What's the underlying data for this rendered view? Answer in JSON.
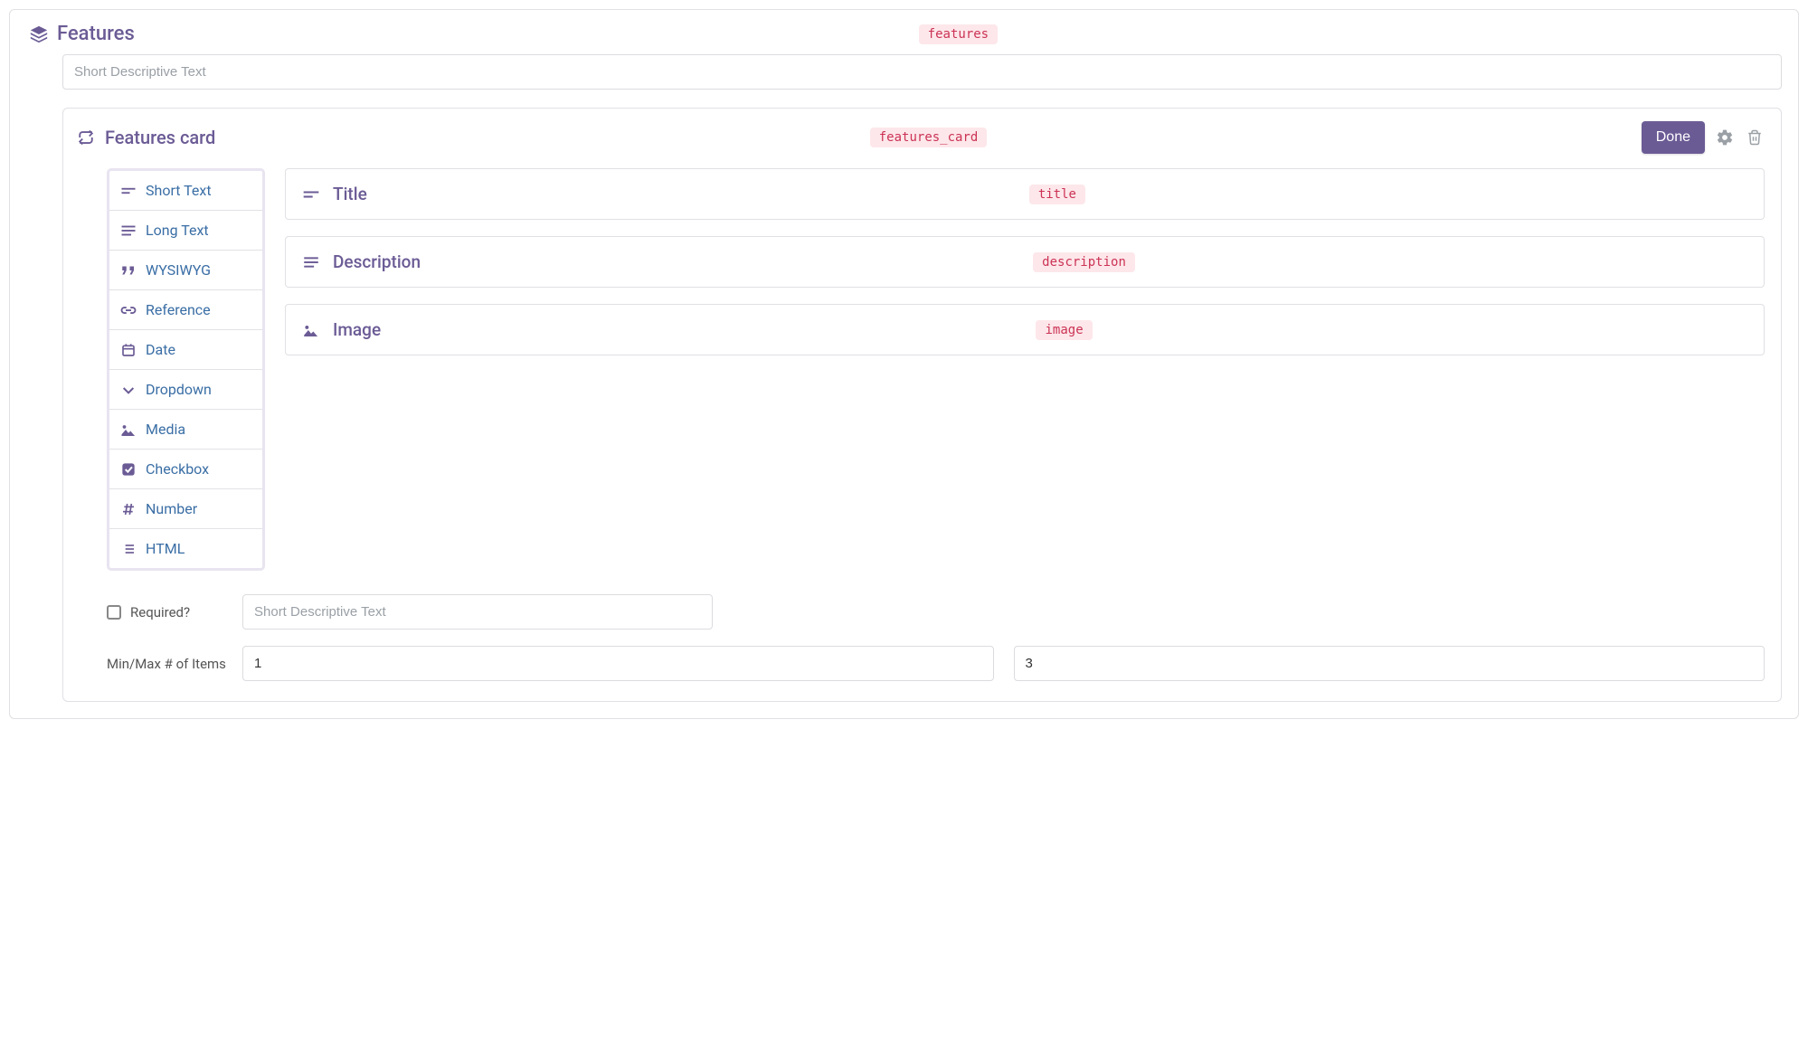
{
  "panel": {
    "title": "Features",
    "slug": "features",
    "desc_placeholder": "Short Descriptive Text"
  },
  "card": {
    "title": "Features card",
    "slug": "features_card",
    "done_label": "Done"
  },
  "field_types": [
    {
      "label": "Short Text",
      "icon": "short-text"
    },
    {
      "label": "Long Text",
      "icon": "long-text"
    },
    {
      "label": "WYSIWYG",
      "icon": "quotes"
    },
    {
      "label": "Reference",
      "icon": "link"
    },
    {
      "label": "Date",
      "icon": "calendar"
    },
    {
      "label": "Dropdown",
      "icon": "chevron-down"
    },
    {
      "label": "Media",
      "icon": "image"
    },
    {
      "label": "Checkbox",
      "icon": "checkbox"
    },
    {
      "label": "Number",
      "icon": "hash"
    },
    {
      "label": "HTML",
      "icon": "list"
    }
  ],
  "fields": [
    {
      "label": "Title",
      "slug": "title",
      "icon": "short-text"
    },
    {
      "label": "Description",
      "slug": "description",
      "icon": "long-text"
    },
    {
      "label": "Image",
      "slug": "image",
      "icon": "image"
    }
  ],
  "settings": {
    "required_label": "Required?",
    "required_checked": false,
    "desc_placeholder": "Short Descriptive Text",
    "minmax_label": "Min/Max # of Items",
    "min_value": "1",
    "max_value": "3"
  }
}
